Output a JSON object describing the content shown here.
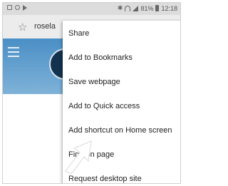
{
  "status_bar": {
    "icons_left": [
      "photo-icon",
      "circle-icon",
      "play-icon"
    ],
    "icons_right": [
      "bluetooth-icon",
      "wifi-icon",
      "signal-icon"
    ],
    "battery": "81%",
    "time": "12:18"
  },
  "url_bar": {
    "star_icon": "star-icon",
    "url": "rosela"
  },
  "menu": {
    "items": [
      {
        "label": "Share"
      },
      {
        "label": "Add to Bookmarks"
      },
      {
        "label": "Save webpage"
      },
      {
        "label": "Add to Quick access"
      },
      {
        "label": "Add shortcut on Home screen"
      },
      {
        "label": "Find on page"
      },
      {
        "label": "Request desktop site"
      }
    ]
  },
  "colors": {
    "status_bar": "#dcdcdc",
    "url_bar": "#ececec",
    "header": "#4a8fc6",
    "menu_bg": "#ffffff",
    "arrow": "#ffffff"
  }
}
